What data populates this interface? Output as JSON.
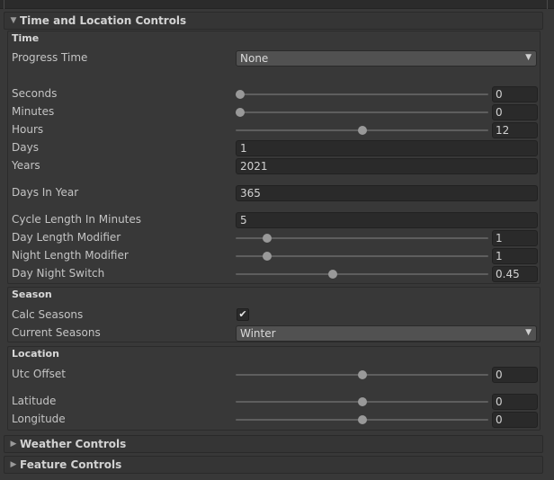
{
  "time_location": {
    "header": "Time and Location Controls",
    "time": {
      "title": "Time",
      "progress_time": {
        "label": "Progress Time",
        "value": "None"
      },
      "seconds": {
        "label": "Seconds",
        "value": "0",
        "fraction": 0.0
      },
      "minutes": {
        "label": "Minutes",
        "value": "0",
        "fraction": 0.0
      },
      "hours": {
        "label": "Hours",
        "value": "12",
        "fraction": 0.5
      },
      "days": {
        "label": "Days",
        "value": "1"
      },
      "years": {
        "label": "Years",
        "value": "2021"
      },
      "days_in_year": {
        "label": "Days In Year",
        "value": "365"
      },
      "cycle_length": {
        "label": "Cycle Length In Minutes",
        "value": "5"
      },
      "day_length": {
        "label": "Day Length Modifier",
        "value": "1",
        "fraction": 0.11
      },
      "night_length": {
        "label": "Night Length Modifier",
        "value": "1",
        "fraction": 0.11
      },
      "day_night_switch": {
        "label": "Day Night Switch",
        "value": "0.45",
        "fraction": 0.38
      }
    },
    "season": {
      "title": "Season",
      "calc_seasons": {
        "label": "Calc Seasons",
        "checked": true,
        "mark": "✔"
      },
      "current_seasons": {
        "label": "Current Seasons",
        "value": "Winter"
      }
    },
    "location": {
      "title": "Location",
      "utc_offset": {
        "label": "Utc Offset",
        "value": "0",
        "fraction": 0.5
      },
      "latitude": {
        "label": "Latitude",
        "value": "0",
        "fraction": 0.5
      },
      "longitude": {
        "label": "Longitude",
        "value": "0",
        "fraction": 0.5
      }
    }
  },
  "weather_controls": {
    "header": "Weather Controls"
  },
  "feature_controls": {
    "header": "Feature Controls"
  },
  "icons": {
    "expanded": "foldout-expanded-icon",
    "collapsed": "foldout-collapsed-icon",
    "dropdown": "dropdown-caret-icon",
    "check": "checkmark-icon"
  }
}
